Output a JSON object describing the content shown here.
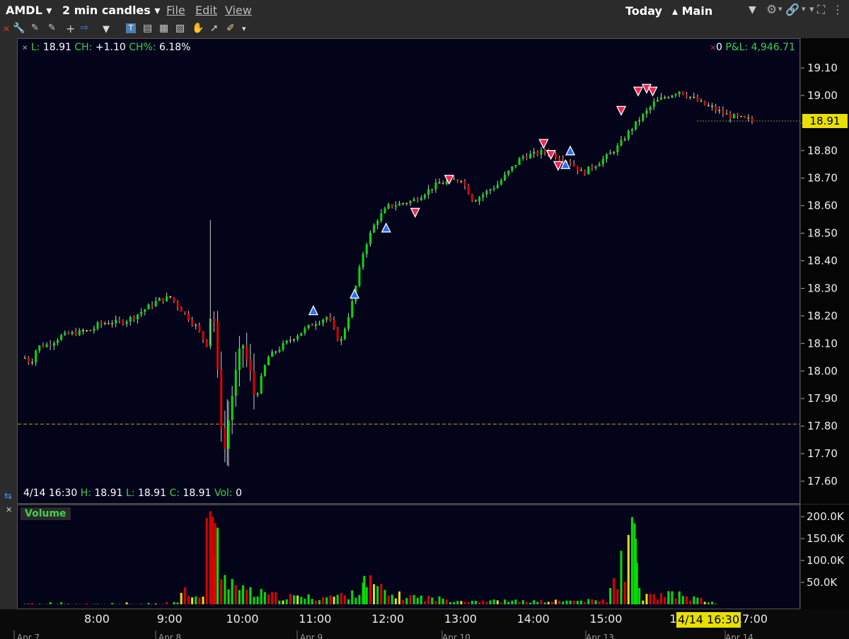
{
  "titlebar": {
    "symbol": "AMDL",
    "interval": "2 min candles",
    "menu": [
      "File",
      "Edit",
      "View"
    ],
    "period": "Today",
    "layout": "Main"
  },
  "header_info": {
    "last_label": "L:",
    "last": "18.91",
    "ch_label": "CH:",
    "ch": "+1.10",
    "chp_label": "CH%:",
    "chp": "6.18%",
    "pos": "0",
    "pnl_label": "P&L:",
    "pnl": "4,946.71"
  },
  "bar_info": {
    "time": "4/14 16:30",
    "h_label": "H:",
    "h": "18.91",
    "l_label": "L:",
    "l": "18.91",
    "c_label": "C:",
    "c": "18.91",
    "vol_label": "Vol:",
    "vol": "0"
  },
  "volume_panel": {
    "title": "Volume"
  },
  "price_axis": {
    "ticks": [
      "19.10",
      "19.00",
      "18.90",
      "18.80",
      "18.70",
      "18.60",
      "18.50",
      "18.40",
      "18.30",
      "18.20",
      "18.10",
      "18.00",
      "17.90",
      "17.80",
      "17.70",
      "17.60"
    ],
    "last_price_tag": "18.91"
  },
  "volume_axis": {
    "ticks": [
      "200.0K",
      "150.0K",
      "100.0K",
      "50.0K"
    ]
  },
  "time_axis": {
    "ticks": [
      "8:00",
      "9:00",
      "10:00",
      "11:00",
      "12:00",
      "13:00",
      "14:00",
      "15:00",
      "16:",
      "17:00"
    ],
    "cursor_label": "4/14 16:30",
    "dates": [
      "Apr 7",
      "Apr 8",
      "Apr 9",
      "Apr 10",
      "Apr 13",
      "Apr 14"
    ]
  },
  "colors": {
    "up": "#00e000",
    "down": "#e00000",
    "flat": "#e8e000",
    "bg": "#03041a",
    "reference_line": "#c8a020",
    "buy_marker": "#2a6cff",
    "sell_marker": "#ff2050"
  },
  "chart_data": {
    "type": "candlestick",
    "title": "AMDL 2 min candles",
    "ylim": [
      17.55,
      19.17
    ],
    "y_ticks": [
      19.1,
      19.0,
      18.9,
      18.8,
      18.7,
      18.6,
      18.5,
      18.4,
      18.3,
      18.2,
      18.1,
      18.0,
      17.9,
      17.8,
      17.7,
      17.6
    ],
    "x_ticks": [
      "8:00",
      "9:00",
      "10:00",
      "11:00",
      "12:00",
      "13:00",
      "14:00",
      "15:00",
      "16:00",
      "17:00"
    ],
    "reference_line": 17.81,
    "last_price": 18.91,
    "price_path": [
      [
        "7:00",
        18.05
      ],
      [
        "7:05",
        18.03
      ],
      [
        "7:10",
        18.09
      ],
      [
        "7:20",
        18.1
      ],
      [
        "7:30",
        18.13
      ],
      [
        "7:40",
        18.14
      ],
      [
        "7:55",
        18.15
      ],
      [
        "8:00",
        18.17
      ],
      [
        "8:10",
        18.18
      ],
      [
        "8:20",
        18.18
      ],
      [
        "8:30",
        18.2
      ],
      [
        "8:40",
        18.23
      ],
      [
        "8:50",
        18.26
      ],
      [
        "9:00",
        18.27
      ],
      [
        "9:10",
        18.22
      ],
      [
        "9:20",
        18.17
      ],
      [
        "9:30",
        18.1
      ],
      [
        "9:35",
        18.26
      ],
      [
        "9:40",
        17.9
      ],
      [
        "9:45",
        17.72
      ],
      [
        "9:50",
        17.9
      ],
      [
        "10:00",
        18.1
      ],
      [
        "10:10",
        17.9
      ],
      [
        "10:20",
        18.05
      ],
      [
        "10:40",
        18.12
      ],
      [
        "11:00",
        18.18
      ],
      [
        "11:10",
        18.2
      ],
      [
        "11:20",
        18.1
      ],
      [
        "11:30",
        18.25
      ],
      [
        "11:40",
        18.45
      ],
      [
        "11:50",
        18.55
      ],
      [
        "12:00",
        18.6
      ],
      [
        "12:20",
        18.62
      ],
      [
        "12:40",
        18.68
      ],
      [
        "13:00",
        18.7
      ],
      [
        "13:10",
        18.62
      ],
      [
        "13:30",
        18.68
      ],
      [
        "13:50",
        18.78
      ],
      [
        "14:10",
        18.8
      ],
      [
        "14:30",
        18.76
      ],
      [
        "14:40",
        18.72
      ],
      [
        "15:00",
        18.78
      ],
      [
        "15:10",
        18.82
      ],
      [
        "15:20",
        18.88
      ],
      [
        "15:40",
        18.98
      ],
      [
        "16:00",
        19.02
      ],
      [
        "16:20",
        18.97
      ],
      [
        "16:40",
        18.93
      ],
      [
        "17:00",
        18.91
      ]
    ],
    "volume_ylim": [
      0,
      210000
    ],
    "volume_bars": [
      [
        "7:00",
        5000
      ],
      [
        "8:00",
        3000
      ],
      [
        "9:00",
        4000
      ],
      [
        "9:35",
        200000
      ],
      [
        "9:37",
        185000
      ],
      [
        "9:40",
        150000
      ],
      [
        "9:45",
        80000
      ],
      [
        "9:50",
        60000
      ],
      [
        "10:00",
        35000
      ],
      [
        "10:30",
        20000
      ],
      [
        "11:00",
        18000
      ],
      [
        "11:30",
        25000
      ],
      [
        "11:40",
        65000
      ],
      [
        "12:00",
        25000
      ],
      [
        "13:00",
        10000
      ],
      [
        "14:00",
        8000
      ],
      [
        "15:00",
        10000
      ],
      [
        "15:23",
        185000
      ],
      [
        "15:25",
        55000
      ],
      [
        "15:30",
        20000
      ],
      [
        "16:00",
        25000
      ],
      [
        "16:30",
        3000
      ]
    ],
    "trade_markers": [
      [
        "10:58",
        18.22,
        "buy"
      ],
      [
        "11:32",
        18.28,
        "buy"
      ],
      [
        "11:58",
        18.52,
        "buy"
      ],
      [
        "12:22",
        18.58,
        "sell"
      ],
      [
        "12:50",
        18.7,
        "sell"
      ],
      [
        "14:08",
        18.83,
        "sell"
      ],
      [
        "14:14",
        18.79,
        "sell"
      ],
      [
        "14:20",
        18.75,
        "sell"
      ],
      [
        "14:26",
        18.75,
        "buy"
      ],
      [
        "14:30",
        18.8,
        "buy"
      ],
      [
        "15:12",
        18.95,
        "sell"
      ],
      [
        "15:26",
        19.02,
        "sell"
      ],
      [
        "15:33",
        19.03,
        "sell"
      ],
      [
        "15:38",
        19.02,
        "sell"
      ]
    ]
  }
}
